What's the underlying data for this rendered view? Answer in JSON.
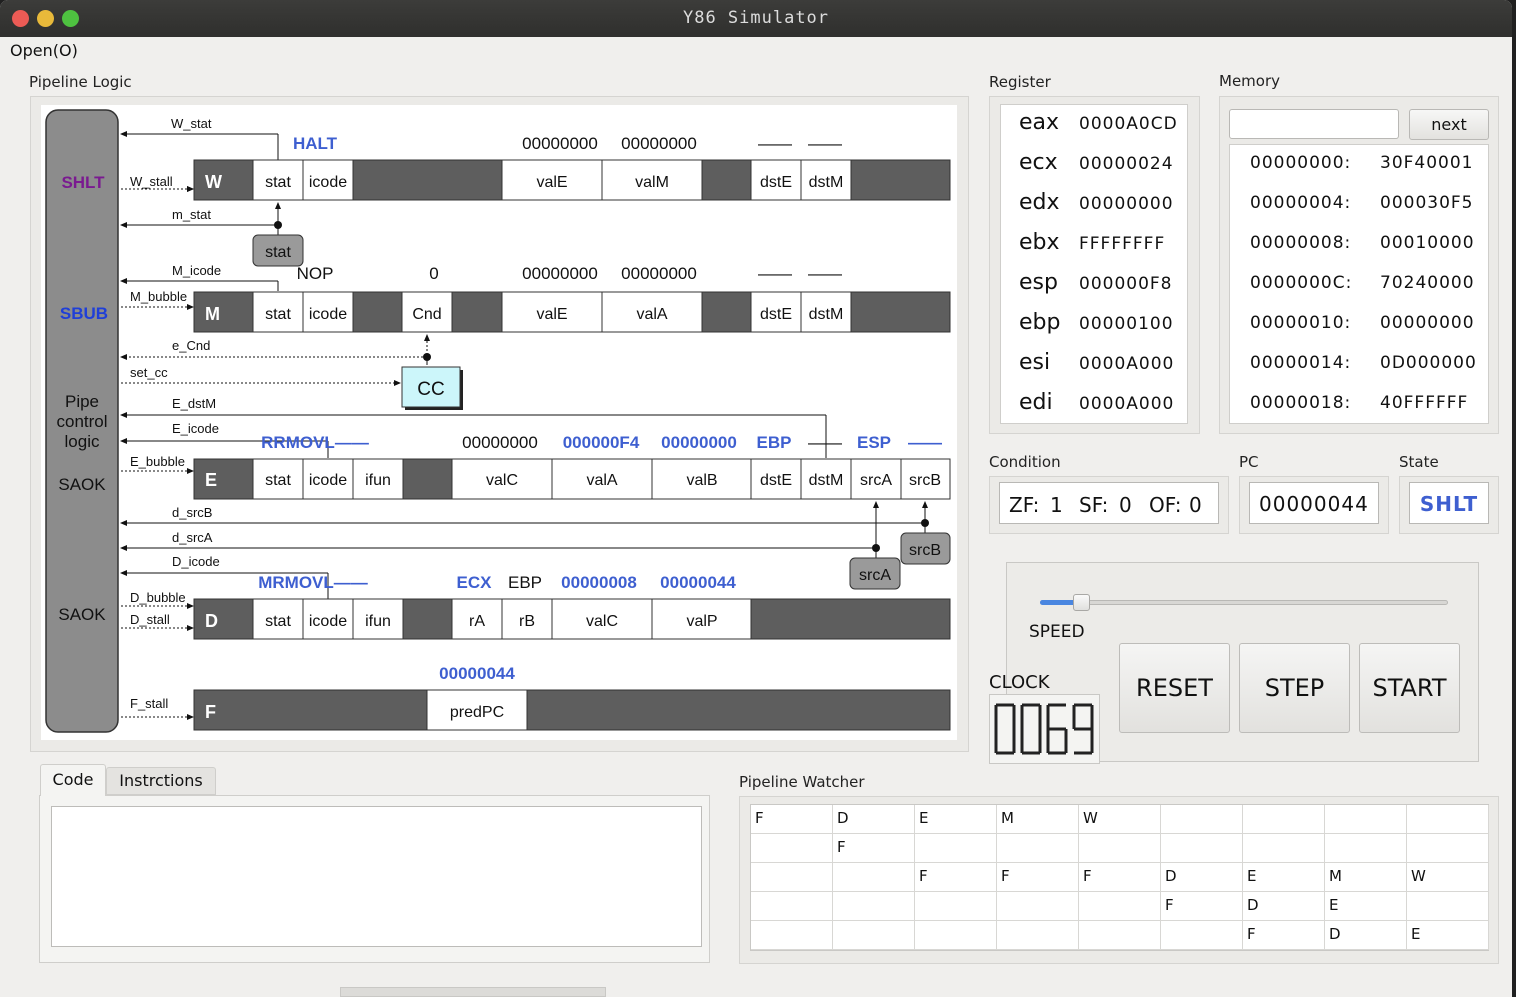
{
  "window": {
    "title": "Y86 Simulator"
  },
  "menu": {
    "open": "Open(O)"
  },
  "pipeline": {
    "group_label": "Pipeline Logic",
    "side": {
      "w_status": "SHLT",
      "m_status": "SBUB",
      "pipe_line1": "Pipe",
      "pipe_line2": "control",
      "pipe_line3": "logic",
      "e_status": "SAOK",
      "d_status": "SAOK"
    },
    "signals": {
      "w_stat": "W_stat",
      "w_stall": "W_stall",
      "m_stat": "m_stat",
      "m_icode": "M_icode",
      "m_bubble": "M_bubble",
      "e_cnd": "e_Cnd",
      "set_cc": "set_cc",
      "e_dstm": "E_dstM",
      "e_icode": "E_icode",
      "e_bubble": "E_bubble",
      "d_srcb": "d_srcB",
      "d_srca": "d_srcA",
      "d_icode": "D_icode",
      "d_bubble": "D_bubble",
      "d_stall": "D_stall",
      "f_stall": "F_stall"
    },
    "W": {
      "name": "W",
      "stat_label": "stat",
      "icode_label": "icode",
      "vale_label": "valE",
      "valm_label": "valM",
      "dste_label": "dstE",
      "dstm_label": "dstM",
      "icode_val": "HALT",
      "vale_val": "00000000",
      "valm_val": "00000000",
      "dste_val": "——",
      "dstm_val": "——"
    },
    "stat_unit": "stat",
    "M": {
      "name": "M",
      "stat_label": "stat",
      "icode_label": "icode",
      "cnd_label": "Cnd",
      "vale_label": "valE",
      "vala_label": "valA",
      "dste_label": "dstE",
      "dstm_label": "dstM",
      "icode_val": "NOP",
      "cnd_val": "0",
      "vale_val": "00000000",
      "vala_val": "00000000",
      "dste_val": "——",
      "dstm_val": "——"
    },
    "cc_unit": "CC",
    "E": {
      "name": "E",
      "stat_label": "stat",
      "icode_label": "icode",
      "ifun_label": "ifun",
      "valc_label": "valC",
      "vala_label": "valA",
      "valb_label": "valB",
      "dste_label": "dstE",
      "dstm_label": "dstM",
      "srca_label": "srcA",
      "srcb_label": "srcB",
      "icode_val": "RRMOVL——",
      "valc_val": "00000000",
      "vala_val": "000000F4",
      "valb_val": "00000000",
      "dste_val": "EBP",
      "dstm_val": "——",
      "srca_val": "ESP",
      "srcb_val": "——"
    },
    "srcb_unit": "srcB",
    "srca_unit": "srcA",
    "D": {
      "name": "D",
      "stat_label": "stat",
      "icode_label": "icode",
      "ifun_label": "ifun",
      "ra_label": "rA",
      "rb_label": "rB",
      "valc_label": "valC",
      "valp_label": "valP",
      "icode_val": "MRMOVL——",
      "ra_val": "ECX",
      "rb_val": "EBP",
      "valc_val": "00000008",
      "valp_val": "00000044"
    },
    "F": {
      "name": "F",
      "predpc_label": "predPC",
      "predpc_val": "00000044"
    }
  },
  "register": {
    "label": "Register",
    "rows": [
      {
        "name": "eax",
        "value": "0000A0CD"
      },
      {
        "name": "ecx",
        "value": "00000024"
      },
      {
        "name": "edx",
        "value": "00000000"
      },
      {
        "name": "ebx",
        "value": "FFFFFFFF"
      },
      {
        "name": "esp",
        "value": "000000F8"
      },
      {
        "name": "ebp",
        "value": "00000100"
      },
      {
        "name": "esi",
        "value": "0000A000"
      },
      {
        "name": "edi",
        "value": "0000A000"
      }
    ]
  },
  "memory": {
    "label": "Memory",
    "input_value": "",
    "next_label": "next",
    "rows": [
      {
        "addr": "00000000:",
        "value": "30F40001"
      },
      {
        "addr": "00000004:",
        "value": "000030F5"
      },
      {
        "addr": "00000008:",
        "value": "00010000"
      },
      {
        "addr": "0000000C:",
        "value": "70240000"
      },
      {
        "addr": "00000010:",
        "value": "00000000"
      },
      {
        "addr": "00000014:",
        "value": "0D000000"
      },
      {
        "addr": "00000018:",
        "value": "40FFFFFF"
      }
    ]
  },
  "condition": {
    "label": "Condition",
    "zf_label": "ZF:",
    "zf": "1",
    "sf_label": "SF:",
    "sf": "0",
    "of_label": "OF:",
    "of": "0"
  },
  "pc": {
    "label": "PC",
    "value": "00000044"
  },
  "state": {
    "label": "State",
    "value": "SHLT"
  },
  "controls": {
    "speed_label": "SPEED",
    "speed_level": 0.1,
    "clock_label": "CLOCK",
    "clock_value": "0069",
    "reset": "RESET",
    "step": "STEP",
    "start": "START"
  },
  "tabs": {
    "code": "Code",
    "instructions": "Instrctions"
  },
  "code": {
    "text": ""
  },
  "watcher": {
    "label": "Pipeline Watcher",
    "rows": [
      [
        "F",
        "D",
        "E",
        "M",
        "W",
        "",
        "",
        "",
        ""
      ],
      [
        "",
        "F",
        "",
        "",
        "",
        "",
        "",
        "",
        ""
      ],
      [
        "",
        "",
        "F",
        "F",
        "F",
        "D",
        "E",
        "M",
        "W"
      ],
      [
        "",
        "",
        "",
        "",
        "",
        "F",
        "D",
        "E",
        ""
      ],
      [
        "",
        "",
        "",
        "",
        "",
        "",
        "F",
        "D",
        "E"
      ]
    ]
  },
  "colors": {
    "accent_blue": "#3e5fd0",
    "shlt_purple": "#7a1a90",
    "sbub_blue": "#1f3fd8",
    "stage_gray": "#5e5e5e",
    "cc_fill": "#ccf6fa"
  }
}
